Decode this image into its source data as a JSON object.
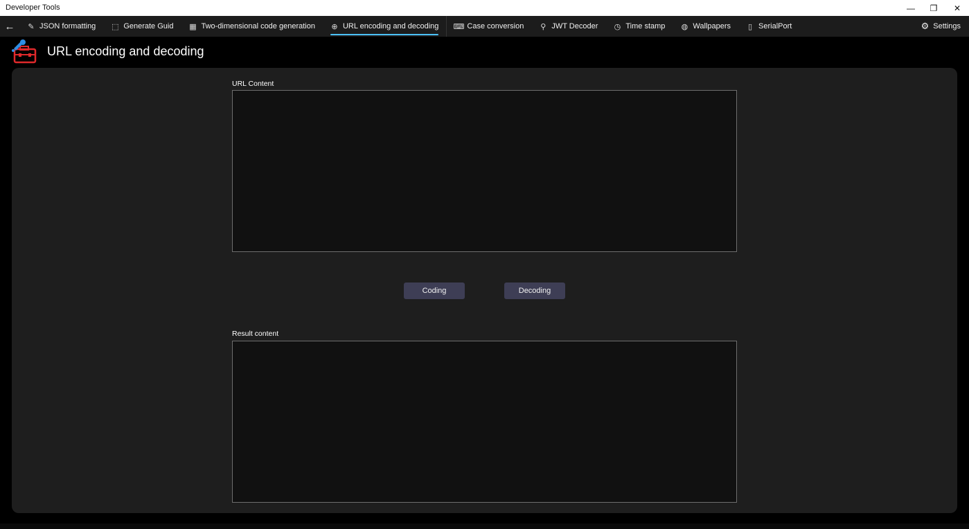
{
  "window": {
    "title": "Developer Tools",
    "minimize_glyph": "—",
    "restore_glyph": "❐",
    "close_glyph": "✕"
  },
  "nav": {
    "back_glyph": "←",
    "items": [
      {
        "label": "JSON formatting",
        "icon": "edit-icon",
        "glyph": "✎"
      },
      {
        "label": "Generate Guid",
        "icon": "guid-icon",
        "glyph": "⬚"
      },
      {
        "label": "Two-dimensional code generation",
        "icon": "qr-code-icon",
        "glyph": "▦"
      },
      {
        "label": "URL encoding and decoding",
        "icon": "globe-icon",
        "glyph": "⊕",
        "active": true
      },
      {
        "label": "Case conversion",
        "icon": "keyboard-icon",
        "glyph": "⌨"
      },
      {
        "label": "JWT Decoder",
        "icon": "key-icon",
        "glyph": "⚲"
      },
      {
        "label": "Time stamp",
        "icon": "clock-icon",
        "glyph": "◷"
      },
      {
        "label": "Wallpapers",
        "icon": "palette-icon",
        "glyph": "◍"
      },
      {
        "label": "SerialPort",
        "icon": "phone-icon",
        "glyph": "▯"
      }
    ],
    "settings_label": "Settings",
    "settings_glyph": "⚙"
  },
  "header": {
    "title": "URL encoding and decoding",
    "logo_icon": "toolbox-icon"
  },
  "main": {
    "url_content_label": "URL Content",
    "url_content_value": "",
    "coding_button": "Coding",
    "decoding_button": "Decoding",
    "result_label": "Result content",
    "result_value": ""
  },
  "colors": {
    "accent": "#4cc2ff",
    "button_bg": "#3e3e55",
    "panel_bg": "#1e1e1e",
    "logo_red": "#e0292b",
    "logo_blue": "#2f8fe6"
  }
}
